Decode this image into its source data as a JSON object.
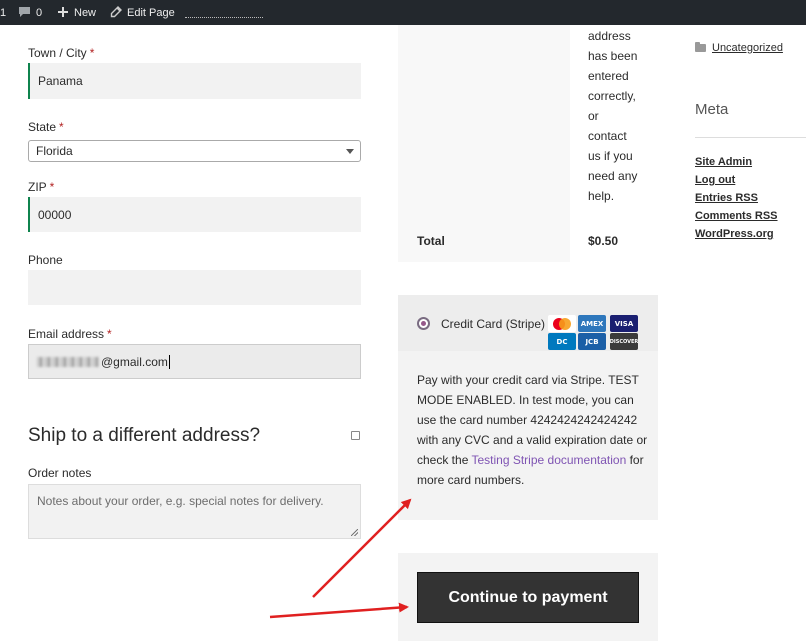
{
  "admin_bar": {
    "site_num": "1",
    "comments_count": "0",
    "new_label": "New",
    "edit_label": "Edit Page"
  },
  "form": {
    "town": {
      "label": "Town / City",
      "required": "*",
      "value": "Panama"
    },
    "state": {
      "label": "State",
      "required": "*",
      "value": "Florida"
    },
    "zip": {
      "label": "ZIP",
      "required": "*",
      "value": "00000"
    },
    "phone": {
      "label": "Phone",
      "value": ""
    },
    "email": {
      "label": "Email address",
      "required": "*",
      "value_visible": "@gmail.com"
    },
    "ship_heading": "Ship to a different address?",
    "notes": {
      "label": "Order notes",
      "placeholder": "Notes about your order, e.g. special notes for delivery."
    }
  },
  "review": {
    "note_lines": [
      "address",
      "has been",
      "entered",
      "correctly,",
      "or",
      "contact",
      "us if you",
      "need any",
      "help."
    ],
    "total_label": "Total",
    "total_value": "$0.50"
  },
  "payment": {
    "method_label": "Credit Card (Stripe)",
    "cards": [
      {
        "name": "mastercard-icon",
        "bg": "#ffffff",
        "text": ""
      },
      {
        "name": "amex-icon",
        "bg": "#2e77bc",
        "text": "AMEX"
      },
      {
        "name": "visa-icon",
        "bg": "#1a1f71",
        "text": "VISA"
      },
      {
        "name": "diners-icon",
        "bg": "#0079be",
        "text": "DC"
      },
      {
        "name": "jcb-icon",
        "bg": "#1b5fa7",
        "text": "JCB"
      },
      {
        "name": "discover-icon",
        "bg": "#3b3b3b",
        "text": "DISCOVER"
      }
    ],
    "description_prefix": "Pay with your credit card via Stripe. TEST MODE ENABLED. In test mode, you can use the card number 4242424242424242 with any CVC and a valid expiration date or check the ",
    "description_link": "Testing Stripe documentation",
    "description_suffix": " for more card numbers.",
    "continue_label": "Continue to payment"
  },
  "sidebar": {
    "category": "Uncategorized",
    "meta_title": "Meta",
    "meta_links": [
      "Site Admin",
      "Log out",
      "Entries RSS",
      "Comments RSS",
      "WordPress.org"
    ]
  },
  "colors": {
    "accent_link": "#7f54b3",
    "button_bg": "#333333",
    "arrow": "#e02020",
    "valid_border": "#0f834d"
  }
}
